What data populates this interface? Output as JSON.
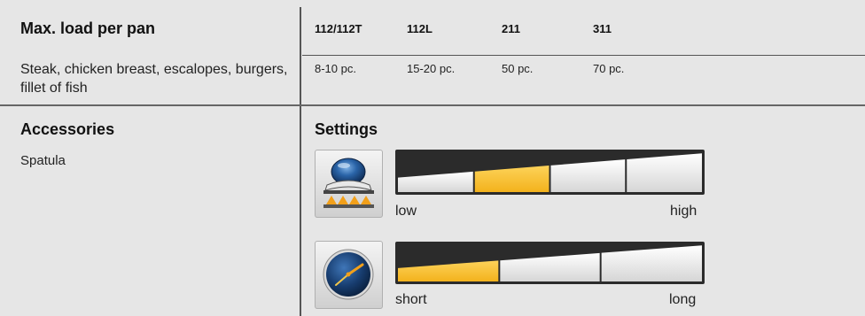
{
  "load_section": {
    "title": "Max. load per pan",
    "food": "Steak, chicken breast, escalopes, burgers, fillet of fish",
    "columns": [
      {
        "model": "112/112T",
        "value": "8-10 pc."
      },
      {
        "model": "112L",
        "value": "15-20 pc."
      },
      {
        "model": "211",
        "value": "50 pc."
      },
      {
        "model": "311",
        "value": "70 pc."
      }
    ]
  },
  "accessories": {
    "title": "Accessories",
    "item": "Spatula"
  },
  "settings": {
    "title": "Settings",
    "heat": {
      "icon": "heat-pan-icon",
      "low_label": "low",
      "high_label": "high",
      "segments": 4,
      "active_segment": 2
    },
    "time": {
      "icon": "clock-icon",
      "short_label": "short",
      "long_label": "long",
      "segments": 3,
      "active_segment": 1
    }
  },
  "colors": {
    "active_fill": "#f3b21c",
    "active_fill_light": "#fdd35a",
    "inactive_fill": "#f2f2f2",
    "bar_border": "#2b2b2b"
  }
}
